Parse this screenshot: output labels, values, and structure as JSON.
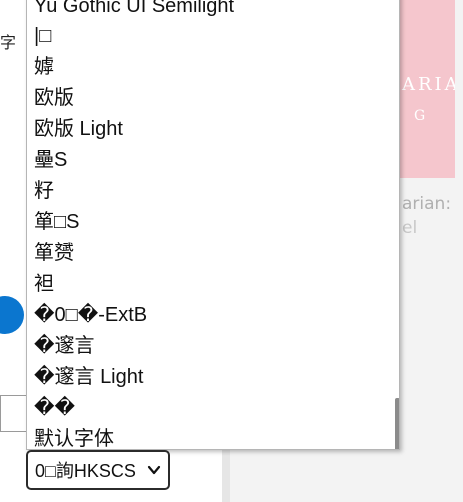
{
  "page": {
    "left_glyph": "字",
    "book": {
      "cover_text": "ARIAN",
      "cover_sub": "G",
      "title_fragment": "arian:",
      "subtitle_fragment": "el"
    }
  },
  "font_select": {
    "selected_value": "0□詢HKSCS",
    "options": [
      "Yu Gothic UI Semilight",
      "|□",
      "嫭",
      "欧版",
      "欧版 Light",
      "壘S",
      "籽",
      "箪□S",
      "箪赟",
      "袒",
      "�0□�-ExtB",
      "�邃言",
      "�邃言 Light",
      "��",
      "默认字体"
    ]
  },
  "colors": {
    "radio_accent": "#0b76cf",
    "cover_pink": "#f5c6cd",
    "content_bg": "#f3f3f3"
  }
}
